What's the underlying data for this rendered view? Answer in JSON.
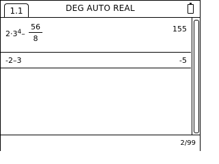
{
  "tab": {
    "label": "1.1"
  },
  "mode": {
    "label": "DEG AUTO REAL"
  },
  "entries": [
    {
      "expression": {
        "prefix": "2·3",
        "exponent": "4",
        "minus": "–",
        "numerator": "56",
        "denominator": "8"
      },
      "result": "155"
    },
    {
      "expression": {
        "text": "-2–3"
      },
      "result": "-5"
    }
  ],
  "status": {
    "page_count": "2/99"
  }
}
